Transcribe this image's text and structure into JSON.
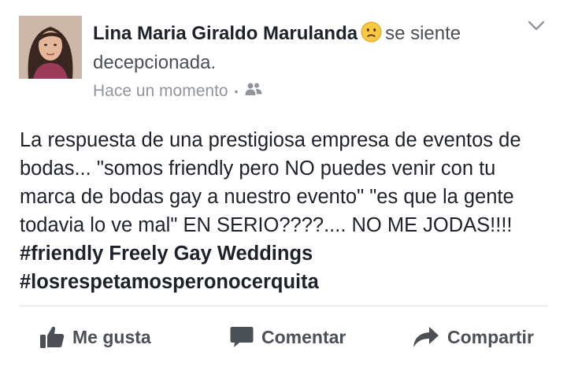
{
  "post": {
    "author": "Lina Maria Giraldo Marulanda",
    "feeling": "se siente decepcionada.",
    "timestamp": "Hace un momento",
    "audience_icon": "friends-icon",
    "body_text": "La respuesta de una prestigiosa empresa de eventos de bodas... \"somos friendly pero NO puedes venir con tu marca de bodas gay a nuestro evento\" \"es que la gente todavia lo ve mal\" EN SERIO????.... NO ME JODAS!!!! ",
    "hashtag_1": "#friendly Freely Gay Weddings",
    "hashtag_2": "#losrespetamosperonocerquita"
  },
  "actions": {
    "like": "Me gusta",
    "comment": "Comentar",
    "share": "Compartir"
  },
  "colors": {
    "text": "#1d2129",
    "secondary": "#90949c",
    "action": "#4b4f56",
    "divider": "#dddfe2",
    "emoji": "#f7c844"
  }
}
